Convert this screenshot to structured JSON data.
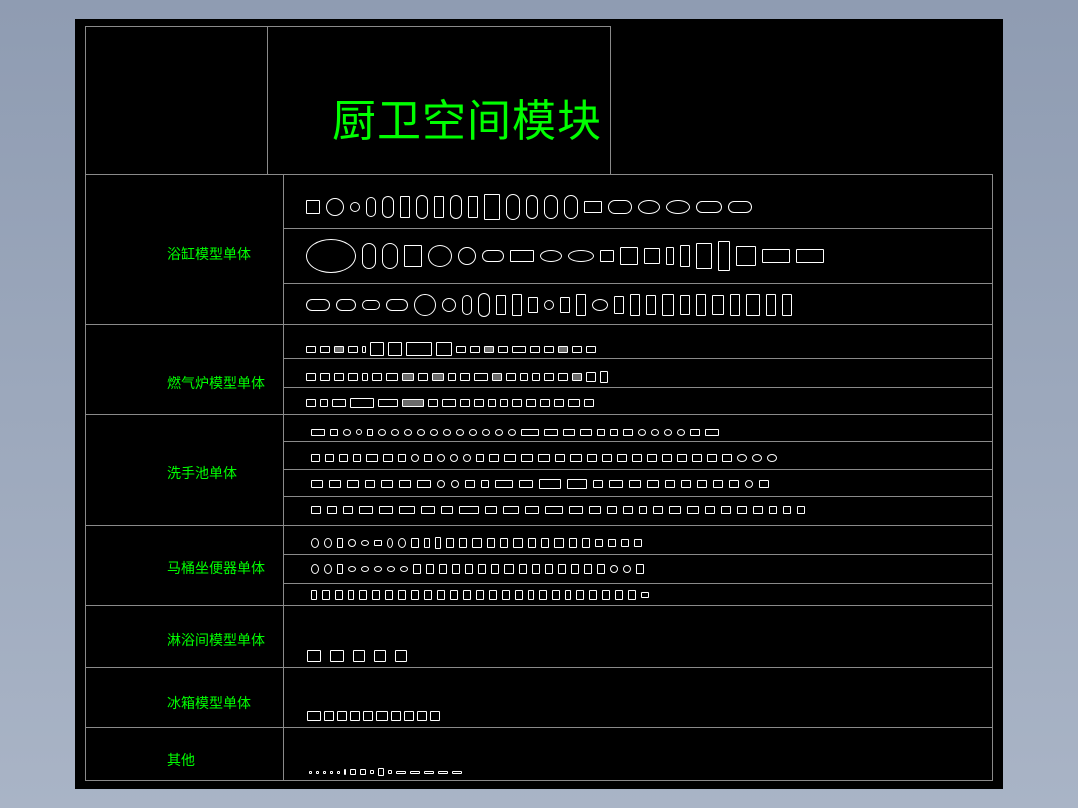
{
  "drawing": {
    "title": "厨卫空间模块",
    "colors": {
      "background": "#000000",
      "text": "#00ff00",
      "lines": "#8a8a8a",
      "symbols": "#ffffff"
    }
  },
  "categories": [
    {
      "id": "bathtub",
      "label": "浴缸模型单体"
    },
    {
      "id": "gas-stove",
      "label": "燃气炉模型单体"
    },
    {
      "id": "washbasin",
      "label": "洗手池单体"
    },
    {
      "id": "toilet",
      "label": "马桶坐便器单体"
    },
    {
      "id": "shower",
      "label": "淋浴间模型单体"
    },
    {
      "id": "fridge",
      "label": "冰箱模型单体"
    },
    {
      "id": "other",
      "label": "其他"
    }
  ]
}
